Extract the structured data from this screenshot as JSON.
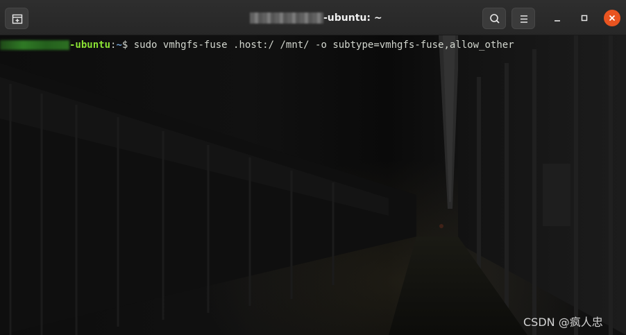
{
  "window": {
    "title": "-ubuntu: ~",
    "title_redacted": true,
    "icons": {
      "new_tab": "new-tab-icon",
      "search": "search-icon",
      "menu": "hamburger-menu-icon",
      "minimize": "minimize-icon",
      "maximize": "maximize-icon",
      "close": "close-icon"
    },
    "colors": {
      "titlebar": "#2b2b2b",
      "close_button": "#e95420"
    }
  },
  "terminal": {
    "prompt": {
      "user_redacted": true,
      "host": "-ubuntu",
      "colon": ":",
      "path": "~",
      "symbol": "$ "
    },
    "command": "sudo vmhgfs-fuse .host:/ /mnt/ -o subtype=vmhgfs-fuse,allow_other",
    "colors": {
      "host": "#8ae234",
      "path": "#729fcf",
      "text": "#d3d7cf"
    }
  },
  "watermark": "CSDN @疯人忠"
}
